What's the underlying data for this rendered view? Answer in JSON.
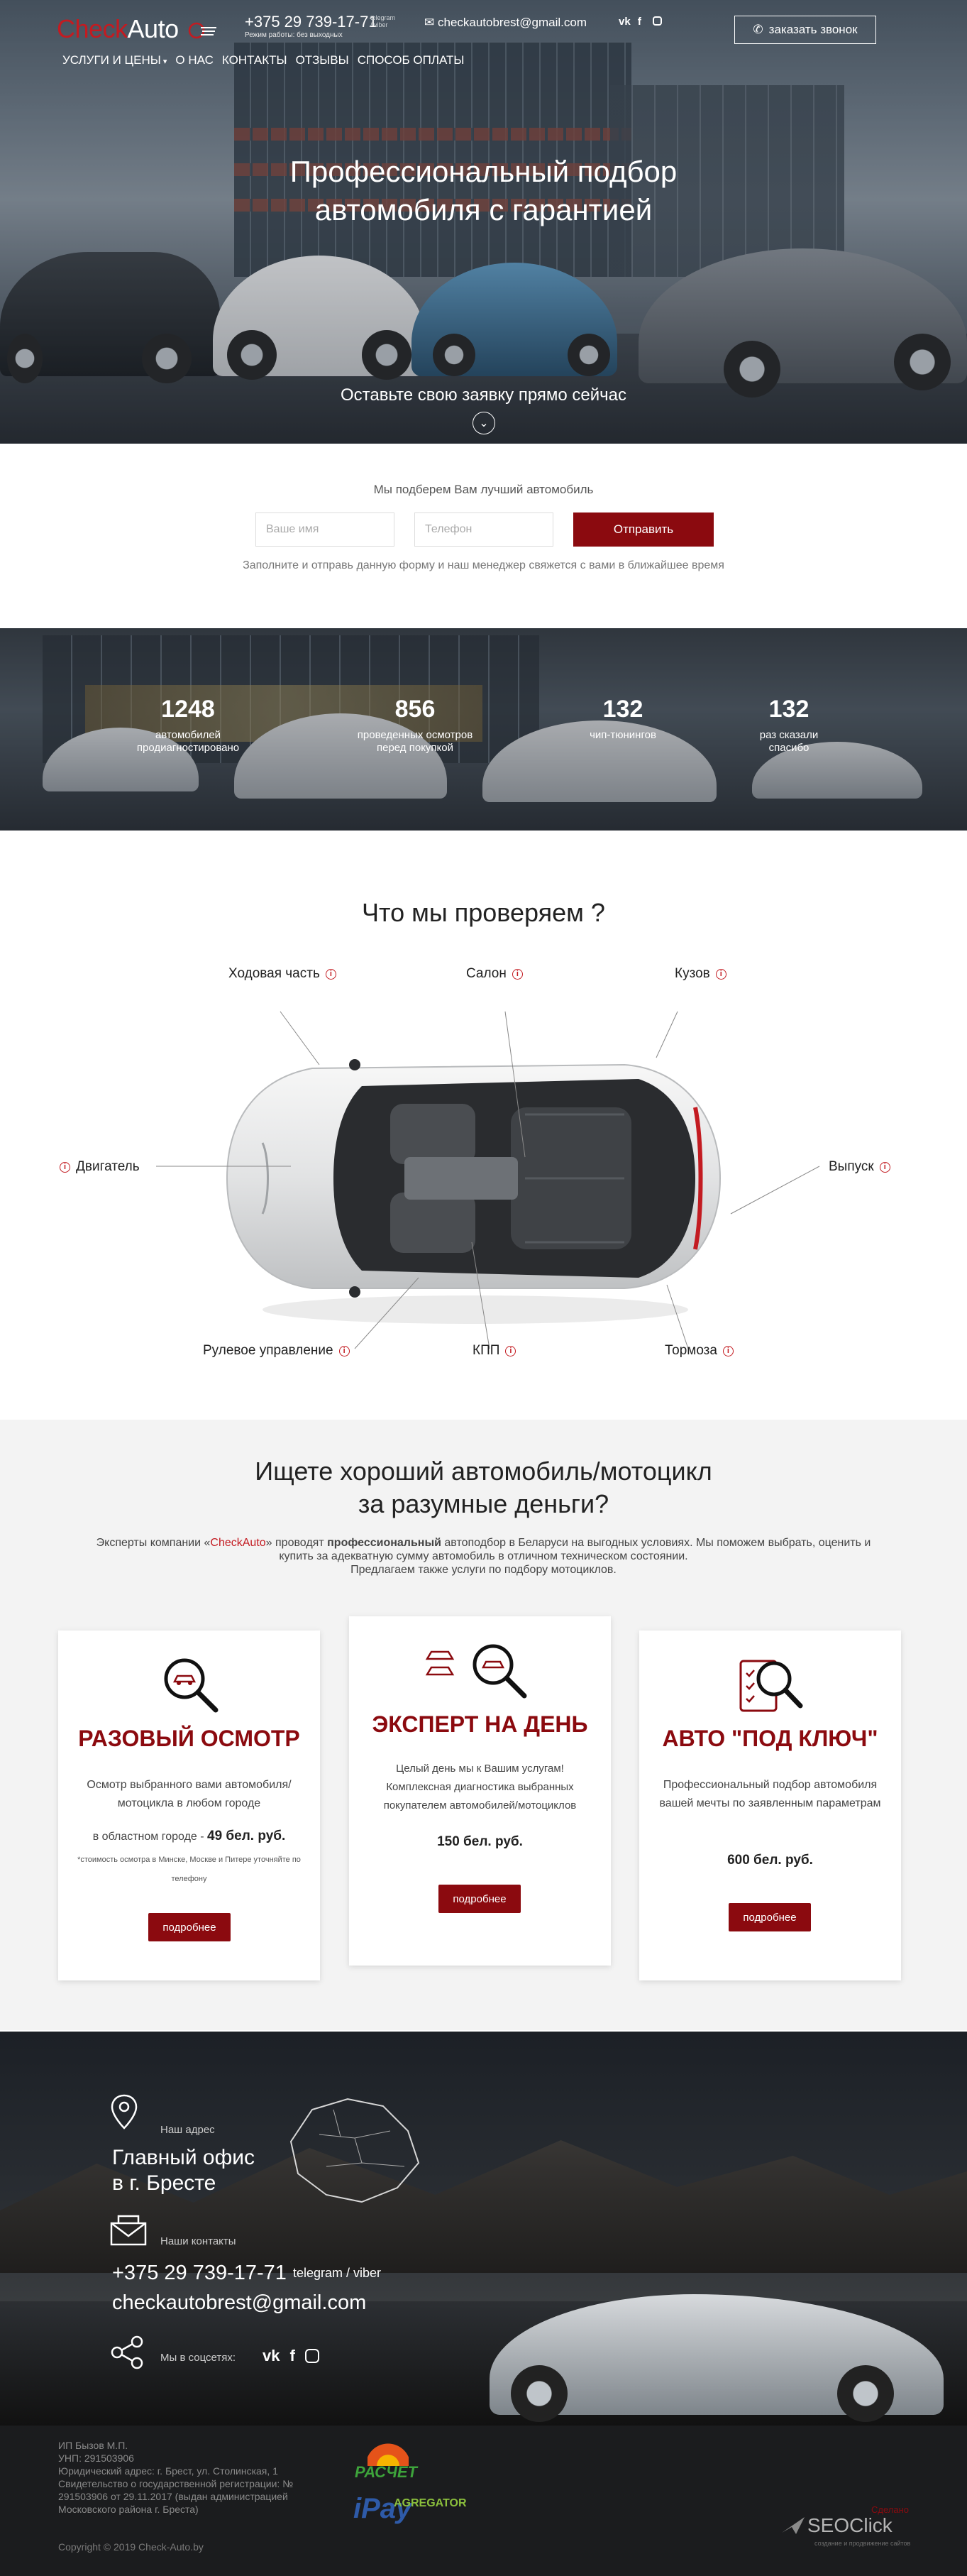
{
  "header": {
    "logo_part1": "Check",
    "logo_part2": "Auto",
    "phone": "+375 29 739-17-71",
    "phone_tag": "telegram / viber",
    "hours": "Режим работы: без выходных",
    "email": "checkautobrest@gmail.com",
    "social": "vk f ig",
    "callback_label": "заказать звонок"
  },
  "nav": [
    "УСЛУГИ И ЦЕНЫ",
    "О НАС",
    "КОНТАКТЫ",
    "ОТЗЫВЫ",
    "СПОСОБ ОПЛАТЫ"
  ],
  "hero": {
    "title_line1": "Профессиональный подбор",
    "title_line2": "автомобиля с гарантией",
    "subtitle": "Оставьте свою заявку прямо сейчас"
  },
  "form": {
    "heading": "Мы подберем Вам лучший автомобиль",
    "name_placeholder": "Ваше имя",
    "phone_placeholder": "Телефон",
    "submit_label": "Отправить",
    "note": "Заполните и отправь данную форму и наш менеджер свяжется с вами в ближайшее время"
  },
  "stats": [
    {
      "number": "1248",
      "label": "автомобилей продиагностировано"
    },
    {
      "number": "856",
      "label": "проведенных осмотров перед покупкой"
    },
    {
      "number": "132",
      "label": "чип-тюнингов"
    },
    {
      "number": "132",
      "label": "раз сказали спасибо"
    }
  ],
  "inspect": {
    "title": "Что мы проверяем ?",
    "points": {
      "chassis": "Ходовая часть",
      "salon": "Салон",
      "body": "Кузов",
      "engine": "Двигатель",
      "exhaust": "Выпуск",
      "steering": "Рулевое управление",
      "gearbox": "КПП",
      "brakes": "Тормоза"
    }
  },
  "services": {
    "title_line1": "Ищете хороший автомобиль/мотоцикл",
    "title_line2": "за разумные деньги?",
    "text_part1": "Эксперты компании «",
    "text_brand": "CheckAuto",
    "text_part2": "» проводят ",
    "text_bold": "профессиональный",
    "text_part3": " автоподбор в Беларуси на выгодных условиях. Мы поможем выбрать, оценить и купить за адекватную сумму автомобиль в отличном техническом состоянии.",
    "text_line2": "Предлагаем также услуги по подбору мотоциклов.",
    "cards": [
      {
        "title": "РАЗОВЫЙ ОСМОТР",
        "desc": "Осмотр выбранного вами автомобиля/мотоцикла в любом городе",
        "price_prefix": "в областном городе - ",
        "price": "49 бел. руб.",
        "note": "*стоимость осмотра в Минске, Москве и Питере уточняйте по телефону",
        "button": "подробнее"
      },
      {
        "title": "ЭКСПЕРТ НА ДЕНЬ",
        "desc": "Целый день мы к Вашим услугам! Комплексная диагностика выбранных покупателем автомобилей/мотоциклов",
        "price": "150 бел. руб.",
        "button": "подробнее"
      },
      {
        "title": "АВТО \"ПОД КЛЮЧ\"",
        "desc": "Профессиональный подбор автомобиля вашей мечты по заявленным параметрам",
        "price": "600 бел. руб.",
        "button": "подробнее"
      }
    ]
  },
  "contacts": {
    "address_label": "Наш адрес",
    "address_line1": "Главный офис",
    "address_line2": "в г. Бресте",
    "contacts_label": "Наши контакты",
    "phone": "+375 29 739-17-71",
    "phone_tag": "telegram / viber",
    "email": "checkautobrest@gmail.com",
    "social_label": "Мы в соцсетях:"
  },
  "footer": {
    "company": "ИП Бызов М.П.",
    "unp": "УНП: 291503906",
    "address": "Юридический адрес: г. Брест, ул. Столинская, 1",
    "registration": "Свидетельство о государственной регистрации: № 291503906 от 29.11.2017 (выдан администрацией Московского района г. Бреста)",
    "copyright": "Copyright © 2019 Check-Auto.by",
    "erip_label": "РАСЧЕТ",
    "ipay_label": "iPay",
    "agregator_label": "AGREGATOR",
    "dev_small": "Сделано",
    "dev_brand": "SEOClick",
    "dev_sub": "создание и продвижение сайтов"
  },
  "colors": {
    "brand": "#8b0a0f",
    "accent_red": "#c31b21"
  }
}
